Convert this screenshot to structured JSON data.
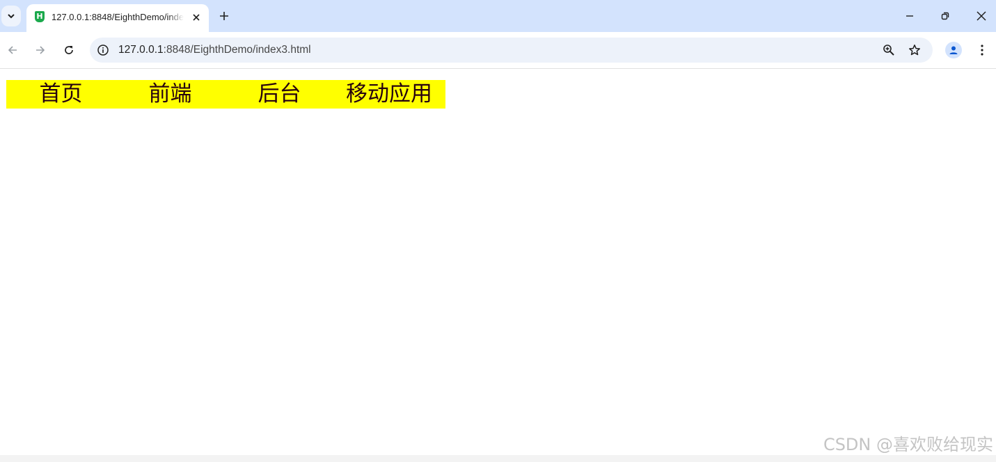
{
  "browser": {
    "tab": {
      "title": "127.0.0.1:8848/EighthDemo/index3.html",
      "favicon_letter": "H",
      "favicon_icon": "hbuilder-icon",
      "favicon_color": "#1ba94c"
    },
    "address_bar": {
      "url_host": "127.0.0.1",
      "url_rest": ":8848/EighthDemo/index3.html"
    },
    "icons": {
      "tab_search": "chevron-down-icon",
      "close_tab": "close-icon",
      "new_tab": "plus-icon",
      "minimize": "minimize-icon",
      "restore": "restore-icon",
      "close_window": "close-icon",
      "back": "arrow-left-icon",
      "forward": "arrow-right-icon",
      "reload": "reload-icon",
      "site_info": "info-icon",
      "zoom": "zoom-icon",
      "bookmark": "star-icon",
      "profile": "person-icon",
      "menu": "more-vertical-icon"
    },
    "colors": {
      "tabstrip": "#d3e3fd",
      "omnibox": "#edf2fa"
    }
  },
  "page": {
    "nav_items": [
      {
        "label": "首页"
      },
      {
        "label": "前端"
      },
      {
        "label": "后台"
      },
      {
        "label": "移动应用"
      }
    ],
    "nav_background": "#ffff00",
    "nav_text_color": "#26000f"
  },
  "watermark": "CSDN @喜欢败给现实"
}
